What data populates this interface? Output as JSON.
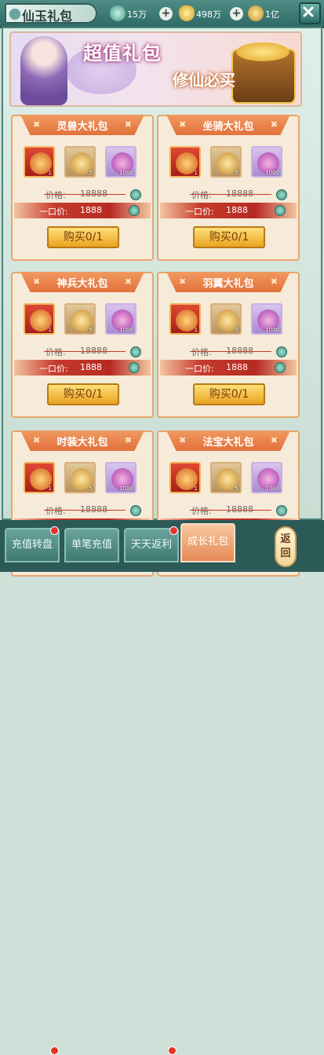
{
  "title": "仙玉礼包",
  "currencies": [
    {
      "icon": "jade-icon",
      "value": "15万"
    },
    {
      "icon": "gold-ingot-icon",
      "value": "498万"
    },
    {
      "icon": "coin-icon",
      "value": "1亿"
    }
  ],
  "banner": {
    "line1": "超值礼包",
    "line2": "修仙必买"
  },
  "price_label": "价格:",
  "deal_label": "一口价:",
  "original_price": "18888",
  "deal_price": "1888",
  "buy_label": "购买0/1",
  "packs": [
    {
      "name": "灵兽大礼包",
      "items": [
        {
          "q": "red",
          "icon": "spirit-beast-egg-icon",
          "count": "1"
        },
        {
          "q": "gold",
          "icon": "purple-orb-icon",
          "count": "5"
        },
        {
          "q": "purple",
          "icon": "pink-gem-icon",
          "count": "1000"
        }
      ]
    },
    {
      "name": "坐骑大礼包",
      "items": [
        {
          "q": "red",
          "icon": "mount-egg-icon",
          "count": "1"
        },
        {
          "q": "gold",
          "icon": "gold-orb-icon",
          "count": "5"
        },
        {
          "q": "purple",
          "icon": "purple-gem-icon",
          "count": "1000"
        }
      ]
    },
    {
      "name": "神兵大礼包",
      "items": [
        {
          "q": "red",
          "icon": "weapon-icon",
          "count": "1"
        },
        {
          "q": "gold",
          "icon": "weapon-shard-icon",
          "count": "5"
        },
        {
          "q": "purple",
          "icon": "red-crystal-icon",
          "count": "1000"
        }
      ]
    },
    {
      "name": "羽翼大礼包",
      "items": [
        {
          "q": "red",
          "icon": "wing-icon",
          "count": "1"
        },
        {
          "q": "gold",
          "icon": "wing-shard-icon",
          "count": "5"
        },
        {
          "q": "purple",
          "icon": "green-crystal-icon",
          "count": "1000"
        }
      ]
    },
    {
      "name": "时装大礼包",
      "items": [
        {
          "q": "red",
          "icon": "fashion-icon",
          "count": "1"
        },
        {
          "q": "gold",
          "icon": "fashion-shard-icon",
          "count": "5"
        },
        {
          "q": "purple",
          "icon": "blue-crystal-icon",
          "count": "1000"
        }
      ]
    },
    {
      "name": "法宝大礼包",
      "items": [
        {
          "q": "red",
          "icon": "magic-treasure-icon",
          "count": "1"
        },
        {
          "q": "gold",
          "icon": "treasure-shard-icon",
          "count": "5"
        },
        {
          "q": "purple",
          "icon": "gold-crystal-icon",
          "count": "1000"
        }
      ]
    }
  ],
  "tabs": [
    {
      "label": "充值转盘",
      "badge": true
    },
    {
      "label": "单笔充值",
      "badge": false
    },
    {
      "label": "天天返利",
      "badge": true
    },
    {
      "label": "成长礼包",
      "badge": false,
      "active": true
    }
  ],
  "back_label": "返回",
  "colors": {
    "accent": "#e3703b",
    "deal": "#b62a22",
    "button": "#e9a41f",
    "frame": "#4c837c"
  }
}
